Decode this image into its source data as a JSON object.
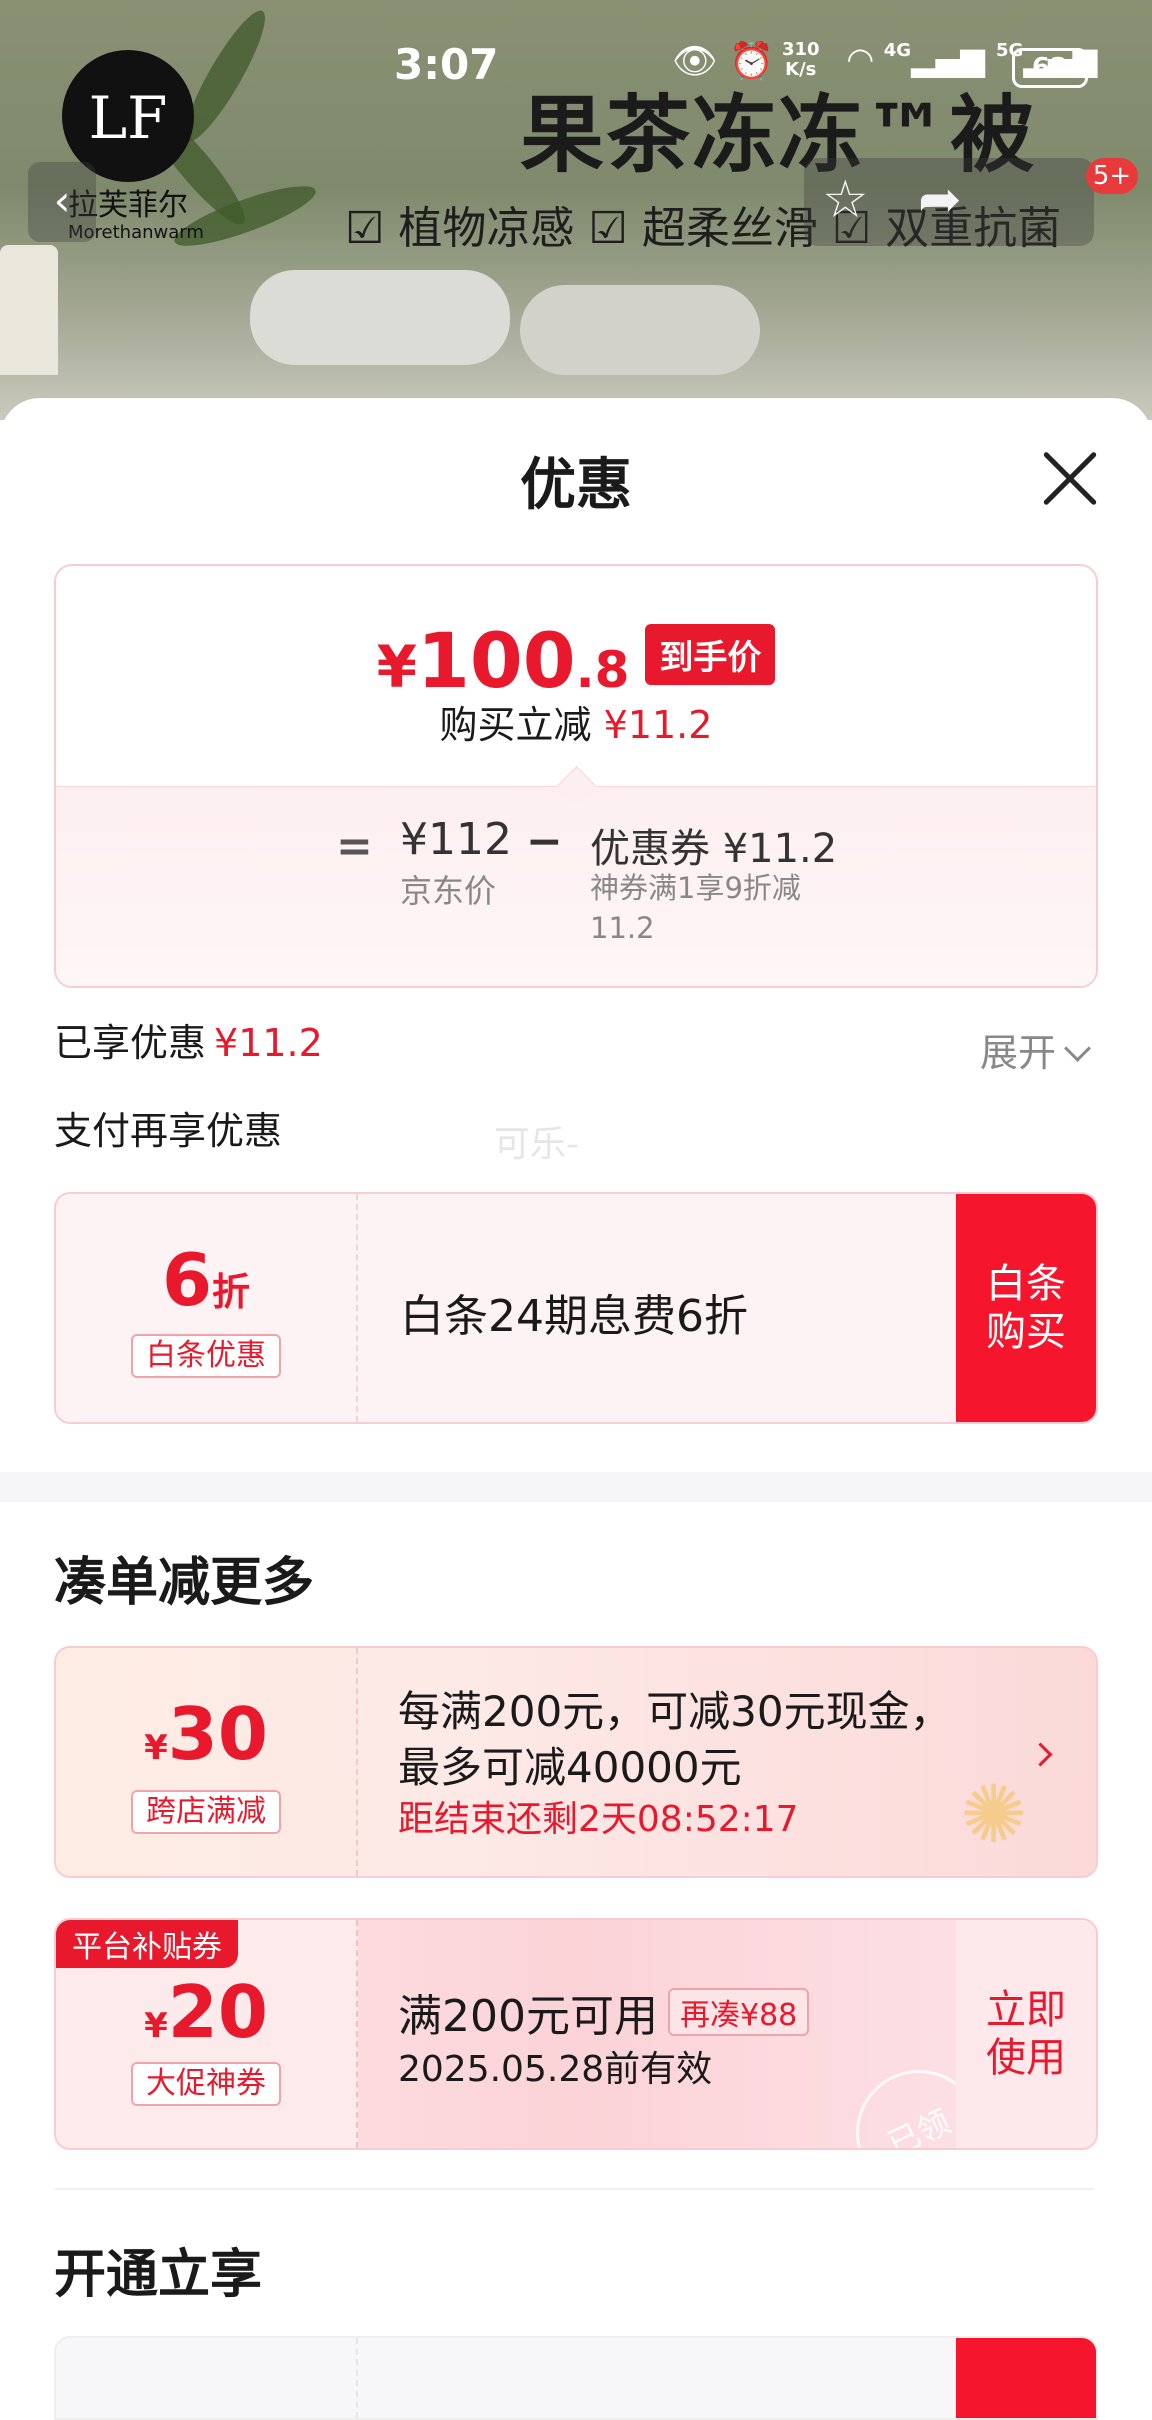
{
  "status_bar": {
    "time": "3:07",
    "speed_value": "310",
    "speed_unit": "K/s",
    "network_1": "4G",
    "network_2": "5G",
    "battery": "62"
  },
  "product_banner": {
    "brand_cn": "拉芙菲尔",
    "brand_en": "Morethanwarm",
    "logo_text": "LF",
    "title": "果茶冻冻™被",
    "features": "☑ 植物凉感  ☑ 超柔丝滑  ☑ 双重抗菌",
    "badge": "5+"
  },
  "sheet": {
    "title": "优惠"
  },
  "price_card": {
    "yen": "¥",
    "price_int": "100",
    "price_dec": ".8",
    "price_tag": "到手价",
    "sub_label": "购买立减",
    "sub_value": "¥11.2",
    "equals": "=",
    "jd_price": "¥112",
    "jd_label": "京东价",
    "minus": "−",
    "coupon_label": "优惠券 ¥11.2",
    "coupon_desc": "神券满1享9折减11.2"
  },
  "summary": {
    "enjoyed_label": "已享优惠",
    "enjoyed_value": "¥11.2",
    "expand_label": "展开",
    "pay_more_label": "支付再享优惠",
    "watermark": "可乐-"
  },
  "baitiao": {
    "discount_number": "6",
    "discount_unit": "折",
    "tag": "白条优惠",
    "title": "白条24期息费6折",
    "button": "白条\n购买"
  },
  "more_section": {
    "title": "凑单减更多"
  },
  "cross_store": {
    "yen": "¥",
    "amount": "30",
    "tag": "跨店满减",
    "line1": "每满200元，可减30元现金，",
    "line2": "最多可减40000元",
    "timer": "距结束还剩2天08:52:17"
  },
  "platform_coupon": {
    "badge": "平台补贴券",
    "yen": "¥",
    "amount": "20",
    "tag": "大促神券",
    "condition": "满200元可用",
    "extra": "再凑¥88",
    "validity": "2025.05.28前有效",
    "button": "立即\n使用",
    "stamp": "已领"
  },
  "open_section": {
    "title": "开通立享"
  },
  "colors": {
    "accent_red": "#e8192c",
    "button_red": "#f5162e",
    "border_pink": "#f6cdd2"
  }
}
